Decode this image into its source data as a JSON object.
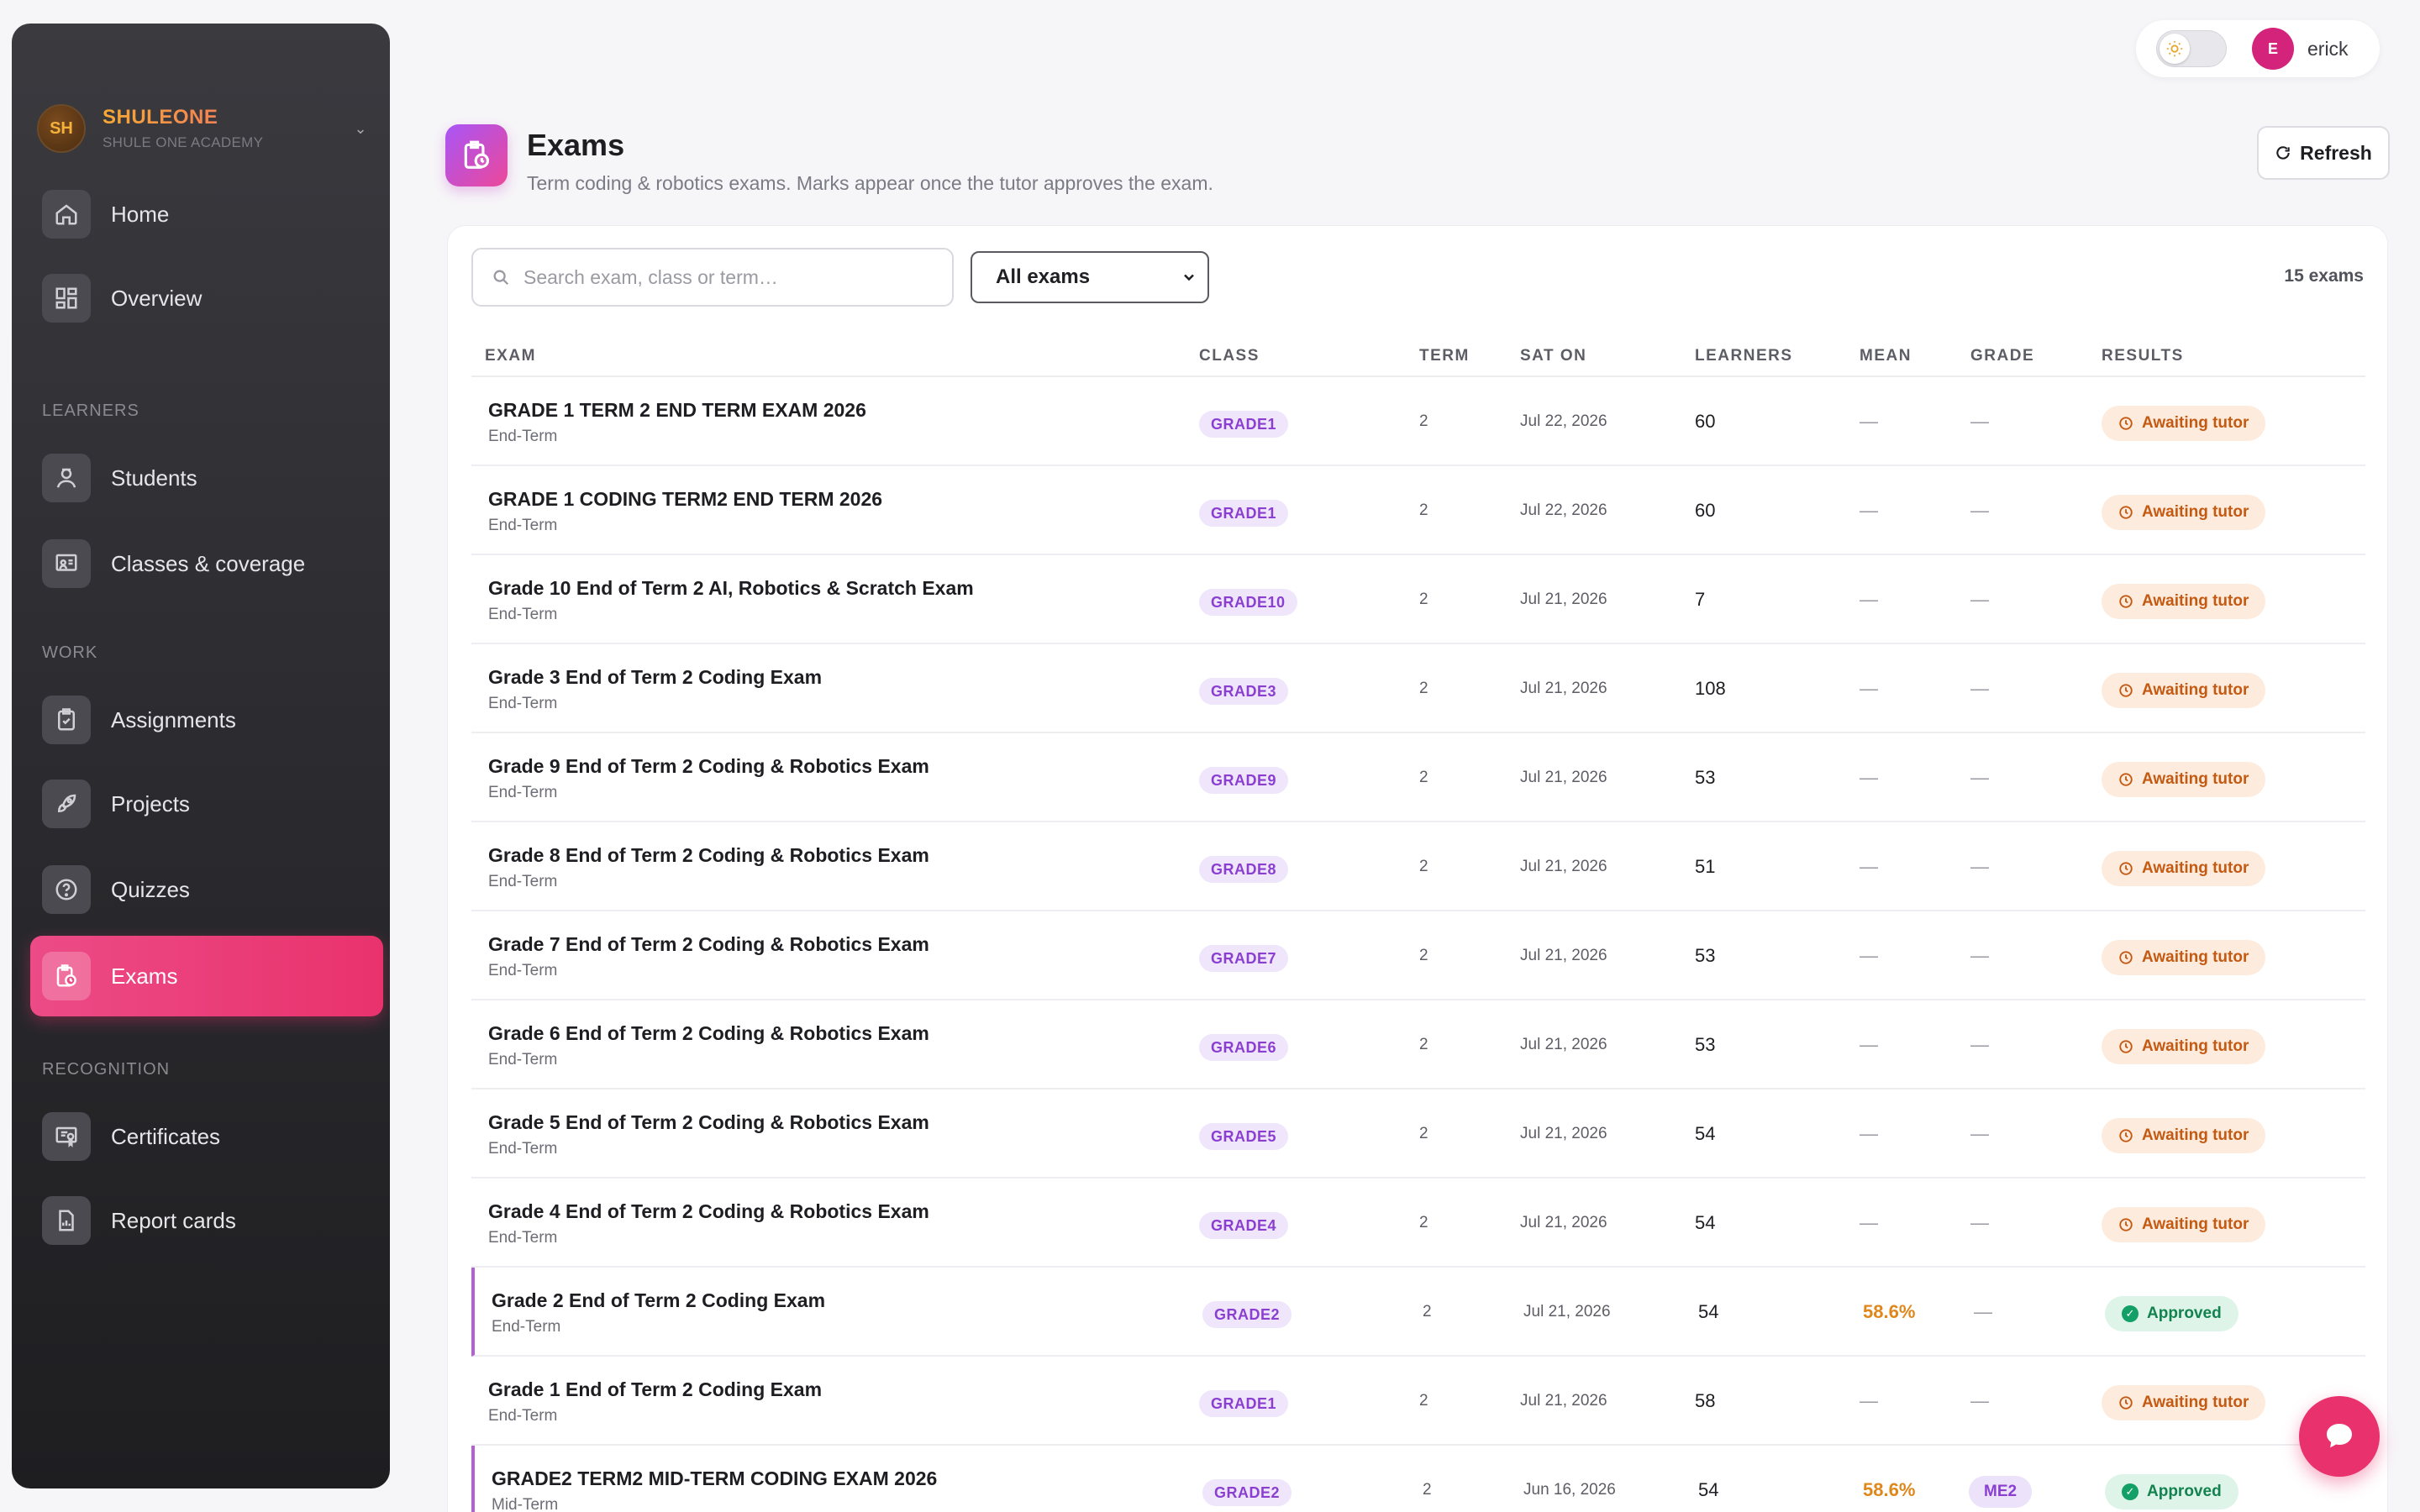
{
  "brand": {
    "initials": "SH",
    "name": "SHULEONE",
    "subtitle": "SHULE ONE ACADEMY"
  },
  "nav": {
    "home": "Home",
    "overview": "Overview",
    "section_learners": "LEARNERS",
    "students": "Students",
    "classes": "Classes & coverage",
    "section_work": "WORK",
    "assignments": "Assignments",
    "projects": "Projects",
    "quizzes": "Quizzes",
    "exams": "Exams",
    "section_recognition": "RECOGNITION",
    "certificates": "Certificates",
    "report_cards": "Report cards"
  },
  "user": {
    "initial": "E",
    "name": "erick"
  },
  "page": {
    "title": "Exams",
    "subtitle": "Term coding & robotics exams. Marks appear once the tutor approves the exam.",
    "refresh_label": "Refresh"
  },
  "filters": {
    "search_placeholder": "Search exam, class or term…",
    "select_value": "All exams",
    "count": "15 exams"
  },
  "table": {
    "headers": {
      "exam": "EXAM",
      "class": "CLASS",
      "term": "TERM",
      "sat_on": "SAT ON",
      "learners": "LEARNERS",
      "mean": "MEAN",
      "grade": "GRADE",
      "results": "RESULTS"
    },
    "rows": [
      {
        "name": "GRADE 1 TERM 2 END TERM EXAM 2026",
        "type": "End-Term",
        "class": "GRADE1",
        "term": "2",
        "date": "Jul 22, 2026",
        "learners": "60",
        "mean": "—",
        "grade": "—",
        "result": "Awaiting tutor"
      },
      {
        "name": "GRADE 1 CODING TERM2 END TERM 2026",
        "type": "End-Term",
        "class": "GRADE1",
        "term": "2",
        "date": "Jul 22, 2026",
        "learners": "60",
        "mean": "—",
        "grade": "—",
        "result": "Awaiting tutor"
      },
      {
        "name": "Grade 10 End of Term 2 AI, Robotics & Scratch Exam",
        "type": "End-Term",
        "class": "GRADE10",
        "term": "2",
        "date": "Jul 21, 2026",
        "learners": "7",
        "mean": "—",
        "grade": "—",
        "result": "Awaiting tutor"
      },
      {
        "name": "Grade 3 End of Term 2 Coding Exam",
        "type": "End-Term",
        "class": "GRADE3",
        "term": "2",
        "date": "Jul 21, 2026",
        "learners": "108",
        "mean": "—",
        "grade": "—",
        "result": "Awaiting tutor"
      },
      {
        "name": "Grade 9 End of Term 2 Coding & Robotics Exam",
        "type": "End-Term",
        "class": "GRADE9",
        "term": "2",
        "date": "Jul 21, 2026",
        "learners": "53",
        "mean": "—",
        "grade": "—",
        "result": "Awaiting tutor"
      },
      {
        "name": "Grade 8 End of Term 2 Coding & Robotics Exam",
        "type": "End-Term",
        "class": "GRADE8",
        "term": "2",
        "date": "Jul 21, 2026",
        "learners": "51",
        "mean": "—",
        "grade": "—",
        "result": "Awaiting tutor"
      },
      {
        "name": "Grade 7 End of Term 2 Coding & Robotics Exam",
        "type": "End-Term",
        "class": "GRADE7",
        "term": "2",
        "date": "Jul 21, 2026",
        "learners": "53",
        "mean": "—",
        "grade": "—",
        "result": "Awaiting tutor"
      },
      {
        "name": "Grade 6 End of Term 2 Coding & Robotics Exam",
        "type": "End-Term",
        "class": "GRADE6",
        "term": "2",
        "date": "Jul 21, 2026",
        "learners": "53",
        "mean": "—",
        "grade": "—",
        "result": "Awaiting tutor"
      },
      {
        "name": "Grade 5 End of Term 2 Coding & Robotics Exam",
        "type": "End-Term",
        "class": "GRADE5",
        "term": "2",
        "date": "Jul 21, 2026",
        "learners": "54",
        "mean": "—",
        "grade": "—",
        "result": "Awaiting tutor"
      },
      {
        "name": "Grade 4 End of Term 2 Coding & Robotics Exam",
        "type": "End-Term",
        "class": "GRADE4",
        "term": "2",
        "date": "Jul 21, 2026",
        "learners": "54",
        "mean": "—",
        "grade": "—",
        "result": "Awaiting tutor"
      },
      {
        "name": "Grade 2 End of Term 2 Coding Exam",
        "type": "End-Term",
        "class": "GRADE2",
        "term": "2",
        "date": "Jul 21, 2026",
        "learners": "54",
        "mean": "58.6%",
        "grade": "—",
        "result": "Approved"
      },
      {
        "name": "Grade 1 End of Term 2 Coding Exam",
        "type": "End-Term",
        "class": "GRADE1",
        "term": "2",
        "date": "Jul 21, 2026",
        "learners": "58",
        "mean": "—",
        "grade": "—",
        "result": "Awaiting tutor"
      },
      {
        "name": "GRADE2 TERM2 MID-TERM CODING EXAM 2026",
        "type": "Mid-Term",
        "class": "GRADE2",
        "term": "2",
        "date": "Jun 16, 2026",
        "learners": "54",
        "mean": "58.6%",
        "grade": "ME2",
        "result": "Approved"
      }
    ]
  },
  "colors": {
    "accent": "#e9326d",
    "class_pill": "#8a3fd1",
    "pending": "#c45a12",
    "approved": "#12824f"
  }
}
